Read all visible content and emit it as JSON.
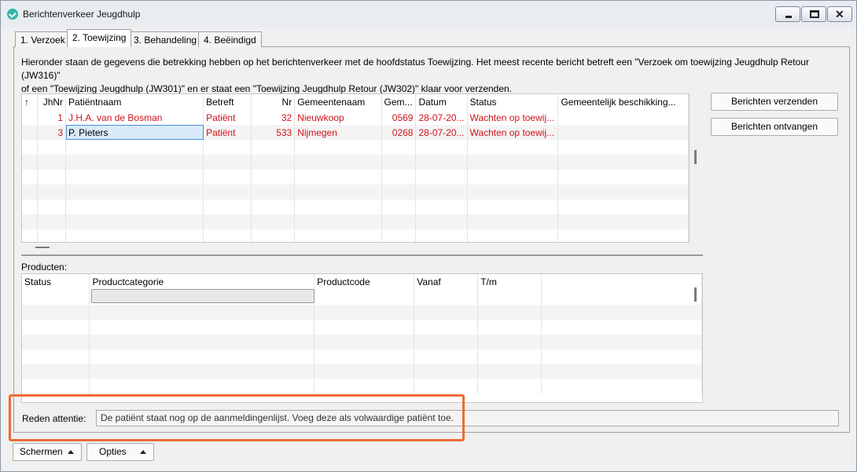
{
  "window": {
    "title": "Berichtenverkeer Jeugdhulp"
  },
  "tabs": [
    {
      "label": "1. Verzoek"
    },
    {
      "label": "2. Toewijzing"
    },
    {
      "label": "3. Behandeling"
    },
    {
      "label": "4. Beëindigd"
    }
  ],
  "info": {
    "line1": "Hieronder staan de gegevens die betrekking hebben op het berichtenverkeer met de hoofdstatus Toewijzing. Het meest recente bericht betreft een \"Verzoek om toewijzing Jeugdhulp Retour (JW316)\"",
    "line2": "of een \"Toewijzing Jeugdhulp (JW301)\" en er staat een \"Toewijzing Jeugdhulp Retour (JW302)\" klaar voor verzenden."
  },
  "main_grid": {
    "columns": {
      "flag": "↑",
      "jhnr": "JhNr",
      "patient": "Patiëntnaam",
      "betreft": "Betreft",
      "nr": "Nr",
      "gemeente": "Gemeentenaam",
      "gem": "Gem...",
      "datum": "Datum",
      "status": "Status",
      "beschikking": "Gemeentelijk beschikking..."
    },
    "rows": [
      {
        "jhnr": "1",
        "patient": "J.H.A. van de Bosman",
        "betreft": "Patiënt",
        "nr": "32",
        "gemeente": "Nieuwkoop",
        "gem": "0569",
        "datum": "28-07-20...",
        "status": "Wachten op toewij...",
        "beschikking": ""
      },
      {
        "jhnr": "3",
        "patient": "P. Pieters",
        "betreft": "Patiënt",
        "nr": "533",
        "gemeente": "Nijmegen",
        "gem": "0268",
        "datum": "28-07-20...",
        "status": "Wachten op toewij...",
        "beschikking": ""
      }
    ]
  },
  "side_buttons": {
    "send": "Berichten verzenden",
    "receive": "Berichten ontvangen"
  },
  "products": {
    "label": "Producten:",
    "columns": {
      "status": "Status",
      "categorie": "Productcategorie",
      "code": "Productcode",
      "vanaf": "Vanaf",
      "tm": "T/m"
    }
  },
  "reden": {
    "label": "Reden attentie:",
    "value": "De patiënt staat nog op de aanmeldingenlijst. Voeg deze als volwaardige patiënt toe."
  },
  "bottom_buttons": {
    "schermen": "Schermen",
    "opties": "Opties"
  },
  "colors": {
    "error_text": "#d0121b",
    "highlight_border": "#ef6b35",
    "app_icon": "#2fb8a8"
  }
}
